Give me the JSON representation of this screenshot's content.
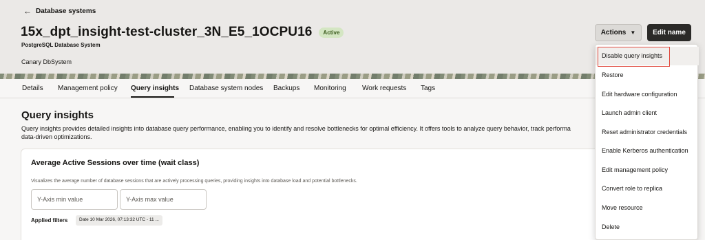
{
  "header": {
    "back_label": "Database systems",
    "title": "15x_dpt_insight-test-cluster_3N_E5_1OCPU16",
    "status_badge": "Active",
    "subtitle": "PostgreSQL Database System",
    "description": "Canary DbSystem",
    "actions_label": "Actions",
    "edit_name_label": "Edit name"
  },
  "tabs": [
    {
      "label": "Details"
    },
    {
      "label": "Management policy"
    },
    {
      "label": "Query insights",
      "active": true
    },
    {
      "label": "Database system nodes"
    },
    {
      "label": "Backups"
    },
    {
      "label": "Monitoring"
    },
    {
      "label": "Work requests"
    },
    {
      "label": "Tags"
    }
  ],
  "main": {
    "title": "Query insights",
    "description": "Query insights provides detailed insights into database query performance, enabling you to identify and resolve bottlenecks for optimal efficiency. It offers tools to analyze query behavior, track performa",
    "description_line2": "data-driven optimizations.",
    "card": {
      "title": "Average Active Sessions over time (wait class)",
      "description": "Visualizes the average number of database sessions that are actively processing queries, providing insights into database load and potential bottlenecks.",
      "y_min_placeholder": "Y-Axis min value",
      "y_max_placeholder": "Y-Axis max value",
      "filters_label": "Applied filters",
      "filter_chip": "Date 10 Mar 2026, 07:13:32 UTC - 11 ..."
    }
  },
  "actions_menu": {
    "items": [
      {
        "label": "Disable query insights"
      },
      {
        "label": "Restore"
      },
      {
        "label": "Edit hardware configuration"
      },
      {
        "label": "Launch admin client"
      },
      {
        "label": "Reset administrator credentials"
      },
      {
        "label": "Enable Kerberos authentication"
      },
      {
        "label": "Edit management policy"
      },
      {
        "label": "Convert role to replica"
      },
      {
        "label": "Move resource"
      },
      {
        "label": "Delete"
      }
    ]
  },
  "colors": {
    "accent_dark": "#2b2a28",
    "active_badge": "#d4e6c3",
    "highlight_outline": "#e0463a"
  }
}
